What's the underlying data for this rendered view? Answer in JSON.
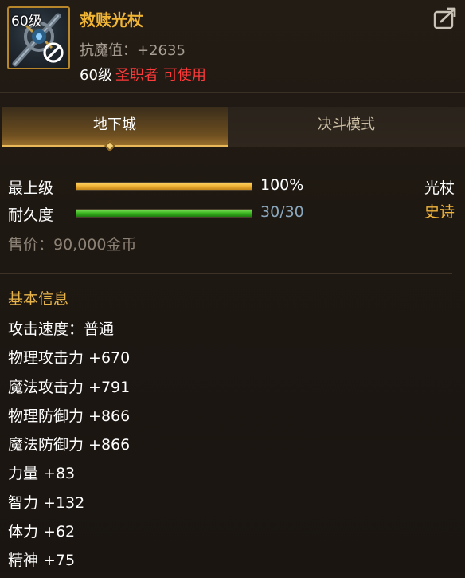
{
  "item": {
    "level_badge": "60级",
    "name": "救赎光杖",
    "stat_line": "抗魔值：+2635",
    "req_level": "60级",
    "req_class": "圣职者",
    "req_use": "可使用",
    "type": "光杖",
    "rarity": "史诗",
    "sell_price": "售价：90,000金币"
  },
  "tabs": [
    {
      "label": "地下城",
      "active": true
    },
    {
      "label": "决斗模式",
      "active": false
    }
  ],
  "bars": {
    "level": {
      "label": "最上级",
      "value_text": "100%",
      "fraction": 1.0
    },
    "durability": {
      "label": "耐久度",
      "value_text": "30/30",
      "fraction": 1.0
    }
  },
  "basic_info": {
    "title": "基本信息",
    "stats": [
      "攻击速度：普通",
      "物理攻击力 +670",
      "魔法攻击力 +791",
      "物理防御力 +866",
      "魔法防御力 +866",
      "力量 +83",
      "智力 +132",
      "体力 +62",
      "精神 +75"
    ]
  },
  "colors": {
    "item_name": "#f0b534",
    "class_restriction": "#ff3a3a",
    "rarity_epic": "#f2b53c",
    "section_title": "#e6b44a",
    "level_bar": "#f0b134",
    "durability_bar": "#3ab31f"
  },
  "icons": {
    "item": "staff-icon",
    "unusable": "no-entry-icon",
    "share": "share-icon",
    "tab_marker": "diamond-marker"
  }
}
